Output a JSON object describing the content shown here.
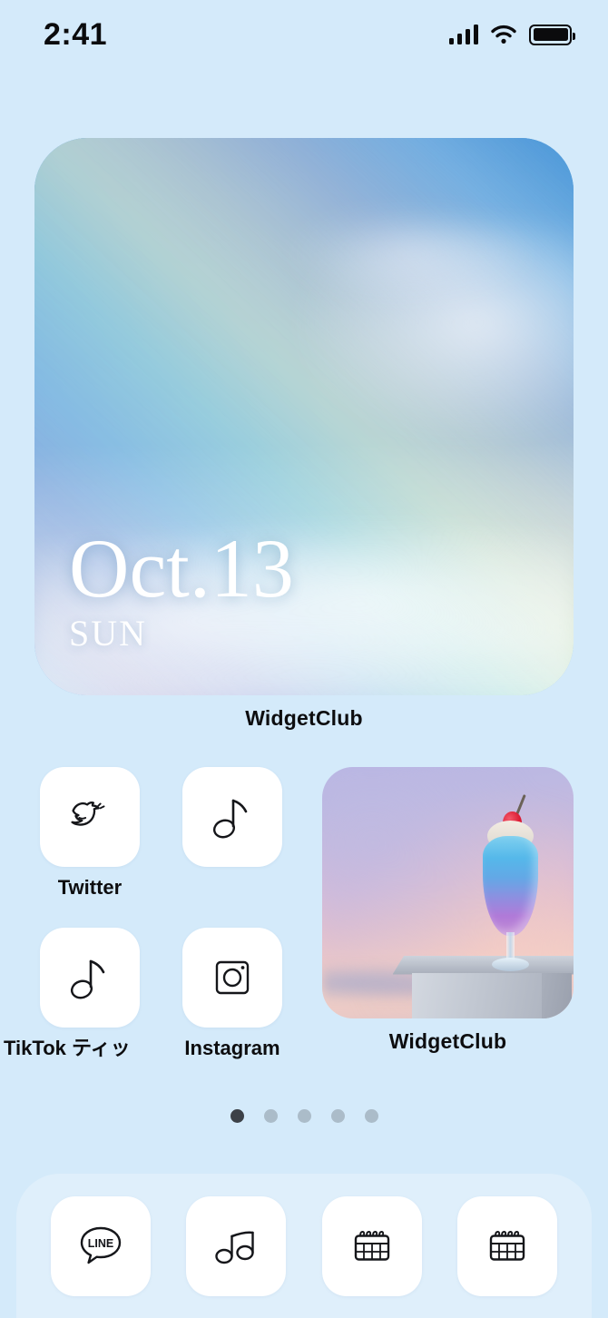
{
  "status_bar": {
    "time": "2:41",
    "signal_icon": "cellular-signal-icon",
    "wifi_icon": "wifi-icon",
    "battery_icon": "battery-full-icon"
  },
  "date_widget": {
    "date": "Oct.13",
    "weekday": "SUN",
    "label": "WidgetClub",
    "background": "rainbow-sky-photo"
  },
  "apps": [
    {
      "name": "Twitter",
      "icon": "twitter-bird-icon",
      "has_label": true
    },
    {
      "name": "",
      "icon": "music-note-icon",
      "has_label": false
    },
    {
      "name": "TikTok ティッ",
      "icon": "music-note-icon",
      "has_label": true
    },
    {
      "name": "Instagram",
      "icon": "instagram-camera-icon",
      "has_label": true
    }
  ],
  "photo_widget": {
    "label": "WidgetClub",
    "background": "cream-soda-sunset-photo"
  },
  "page_dots": {
    "count": 5,
    "active_index": 0
  },
  "dock": [
    {
      "icon": "line-chat-icon",
      "name": "LINE"
    },
    {
      "icon": "music-notes-icon",
      "name": "Music"
    },
    {
      "icon": "calendar-icon",
      "name": "Calendar"
    },
    {
      "icon": "calendar-icon",
      "name": "Calendar"
    }
  ],
  "colors": {
    "background": "#d4eafa",
    "tile": "#ffffff",
    "text": "#0d0d0f",
    "dot_active": "#3c4148"
  }
}
